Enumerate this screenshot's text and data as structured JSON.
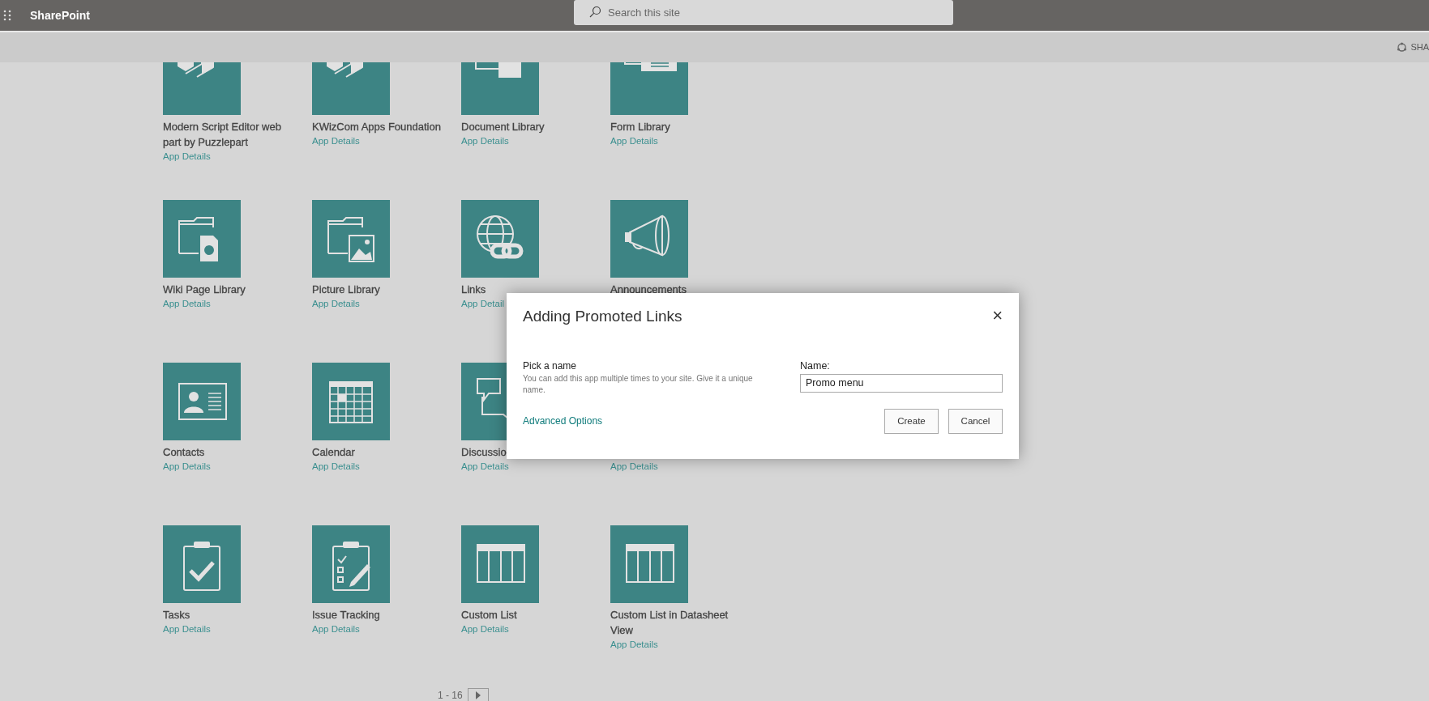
{
  "suite_bar": {
    "app_name": "SharePoint",
    "search": {
      "placeholder": "Search this site"
    }
  },
  "command_bar": {
    "share_label": "SHA"
  },
  "apps": [
    {
      "kind": "script",
      "title": "Modern Script Editor web part by Puzzlepart",
      "link": "App Details"
    },
    {
      "kind": "script",
      "title": "KWizCom Apps Foundation",
      "link": "App Details"
    },
    {
      "kind": "doclib",
      "title": "Document Library",
      "link": "App Details"
    },
    {
      "kind": "formlib",
      "title": "Form Library",
      "link": "App Details"
    },
    {
      "kind": "wiki",
      "title": "Wiki Page Library",
      "link": "App Details"
    },
    {
      "kind": "picture",
      "title": "Picture Library",
      "link": "App Details"
    },
    {
      "kind": "links",
      "title": "Links",
      "link": "App Detail"
    },
    {
      "kind": "megaphone",
      "title": "Announcements"
    },
    {
      "kind": "contacts",
      "title": "Contacts",
      "link": "App Details"
    },
    {
      "kind": "calendar",
      "title": "Calendar",
      "link": "App Details"
    },
    {
      "kind": "discussion",
      "title": "Discussio",
      "link": "App Details"
    },
    {
      "link": "App Details"
    },
    {
      "kind": "tasks",
      "title": "Tasks",
      "link": "App Details"
    },
    {
      "kind": "issue",
      "title": "Issue Tracking",
      "link": "App Details"
    },
    {
      "kind": "list",
      "title": "Custom List",
      "link": "App Details"
    },
    {
      "kind": "list",
      "title": "Custom List in Datasheet View",
      "link": "App Details"
    }
  ],
  "pagination": {
    "range": "1 - 16"
  },
  "dialog": {
    "title": "Adding Promoted Links",
    "close": "×",
    "section_title": "Pick a name",
    "section_text": "You can add this app multiple times to your site. Give it a unique name.",
    "field_label": "Name:",
    "field_value": "Promo menu",
    "advanced_link": "Advanced Options",
    "buttons": [
      "Create",
      "Cancel"
    ]
  }
}
